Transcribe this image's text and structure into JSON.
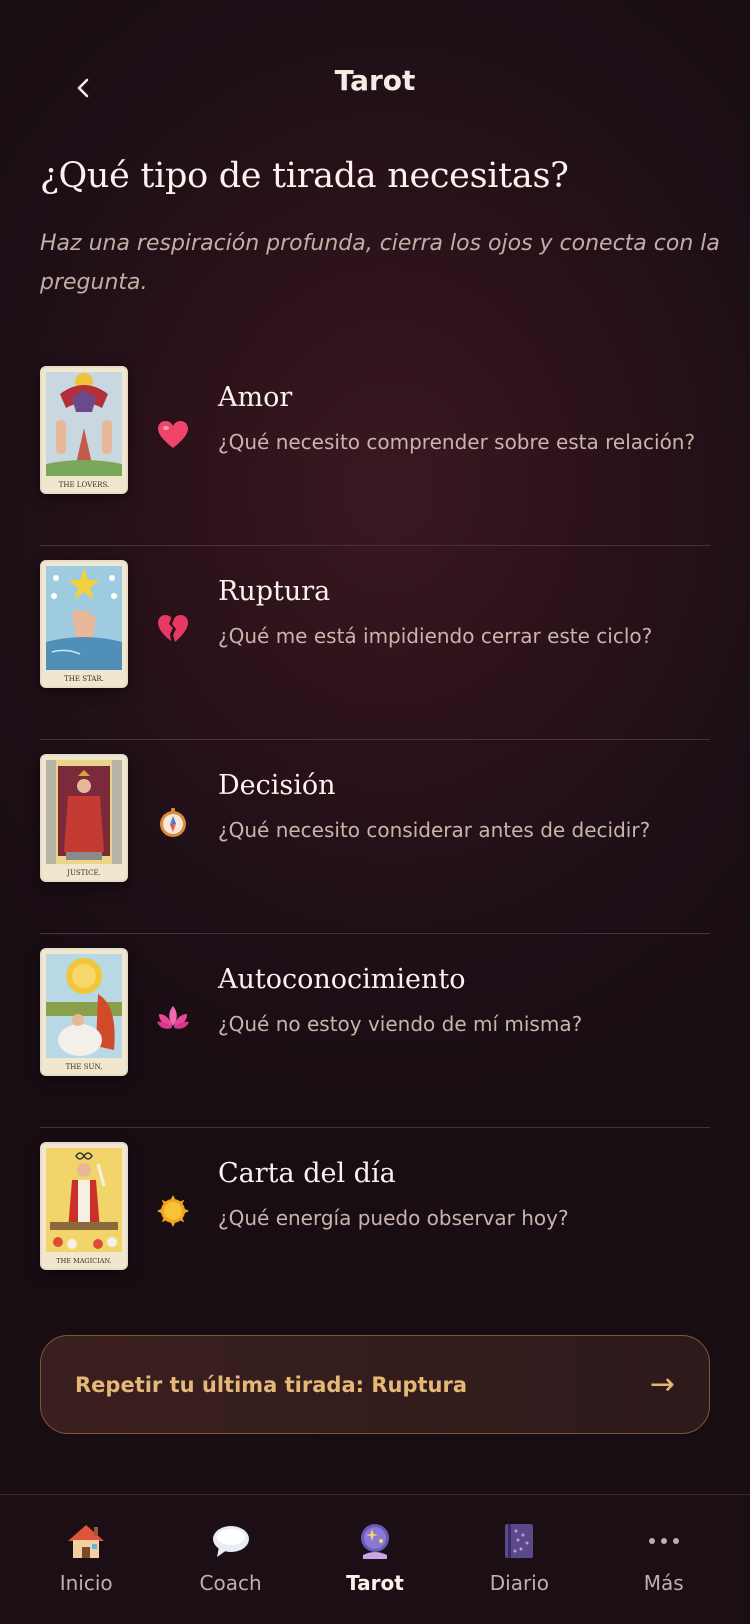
{
  "header": {
    "title": "Tarot",
    "back_icon": "chevron-left-icon"
  },
  "heading": "¿Qué tipo de tirada necesitas?",
  "subheading": "Haz una respiración profunda, cierra los ojos y conecta con la pregunta.",
  "spreads": [
    {
      "title": "Amor",
      "question": "¿Qué necesito comprender sobre esta relación?",
      "icon": "heart-icon",
      "card_caption": "THE LOVERS."
    },
    {
      "title": "Ruptura",
      "question": "¿Qué me está impidiendo cerrar este ciclo?",
      "icon": "broken-heart-icon",
      "card_caption": "THE STAR."
    },
    {
      "title": "Decisión",
      "question": "¿Qué necesito considerar antes de decidir?",
      "icon": "compass-icon",
      "card_caption": "JUSTICE."
    },
    {
      "title": "Autoconocimiento",
      "question": "¿Qué no estoy viendo de mí misma?",
      "icon": "lotus-icon",
      "card_caption": "THE SUN."
    },
    {
      "title": "Carta del día",
      "question": "¿Qué energía puedo observar hoy?",
      "icon": "sun-icon",
      "card_caption": "THE MAGICIAN."
    }
  ],
  "repeat": {
    "label": "Repetir tu última tirada: Ruptura",
    "arrow": "→"
  },
  "nav": [
    {
      "label": "Inicio",
      "icon": "house-icon",
      "active": false
    },
    {
      "label": "Coach",
      "icon": "speech-bubble-icon",
      "active": false
    },
    {
      "label": "Tarot",
      "icon": "crystal-ball-icon",
      "active": true
    },
    {
      "label": "Diario",
      "icon": "notebook-icon",
      "active": false
    },
    {
      "label": "Más",
      "icon": "more-icon",
      "active": false
    }
  ],
  "colors": {
    "accent": "#e5b878",
    "background": "#1d0f16",
    "text": "#fbf2ec",
    "muted": "#c9b4ab"
  }
}
